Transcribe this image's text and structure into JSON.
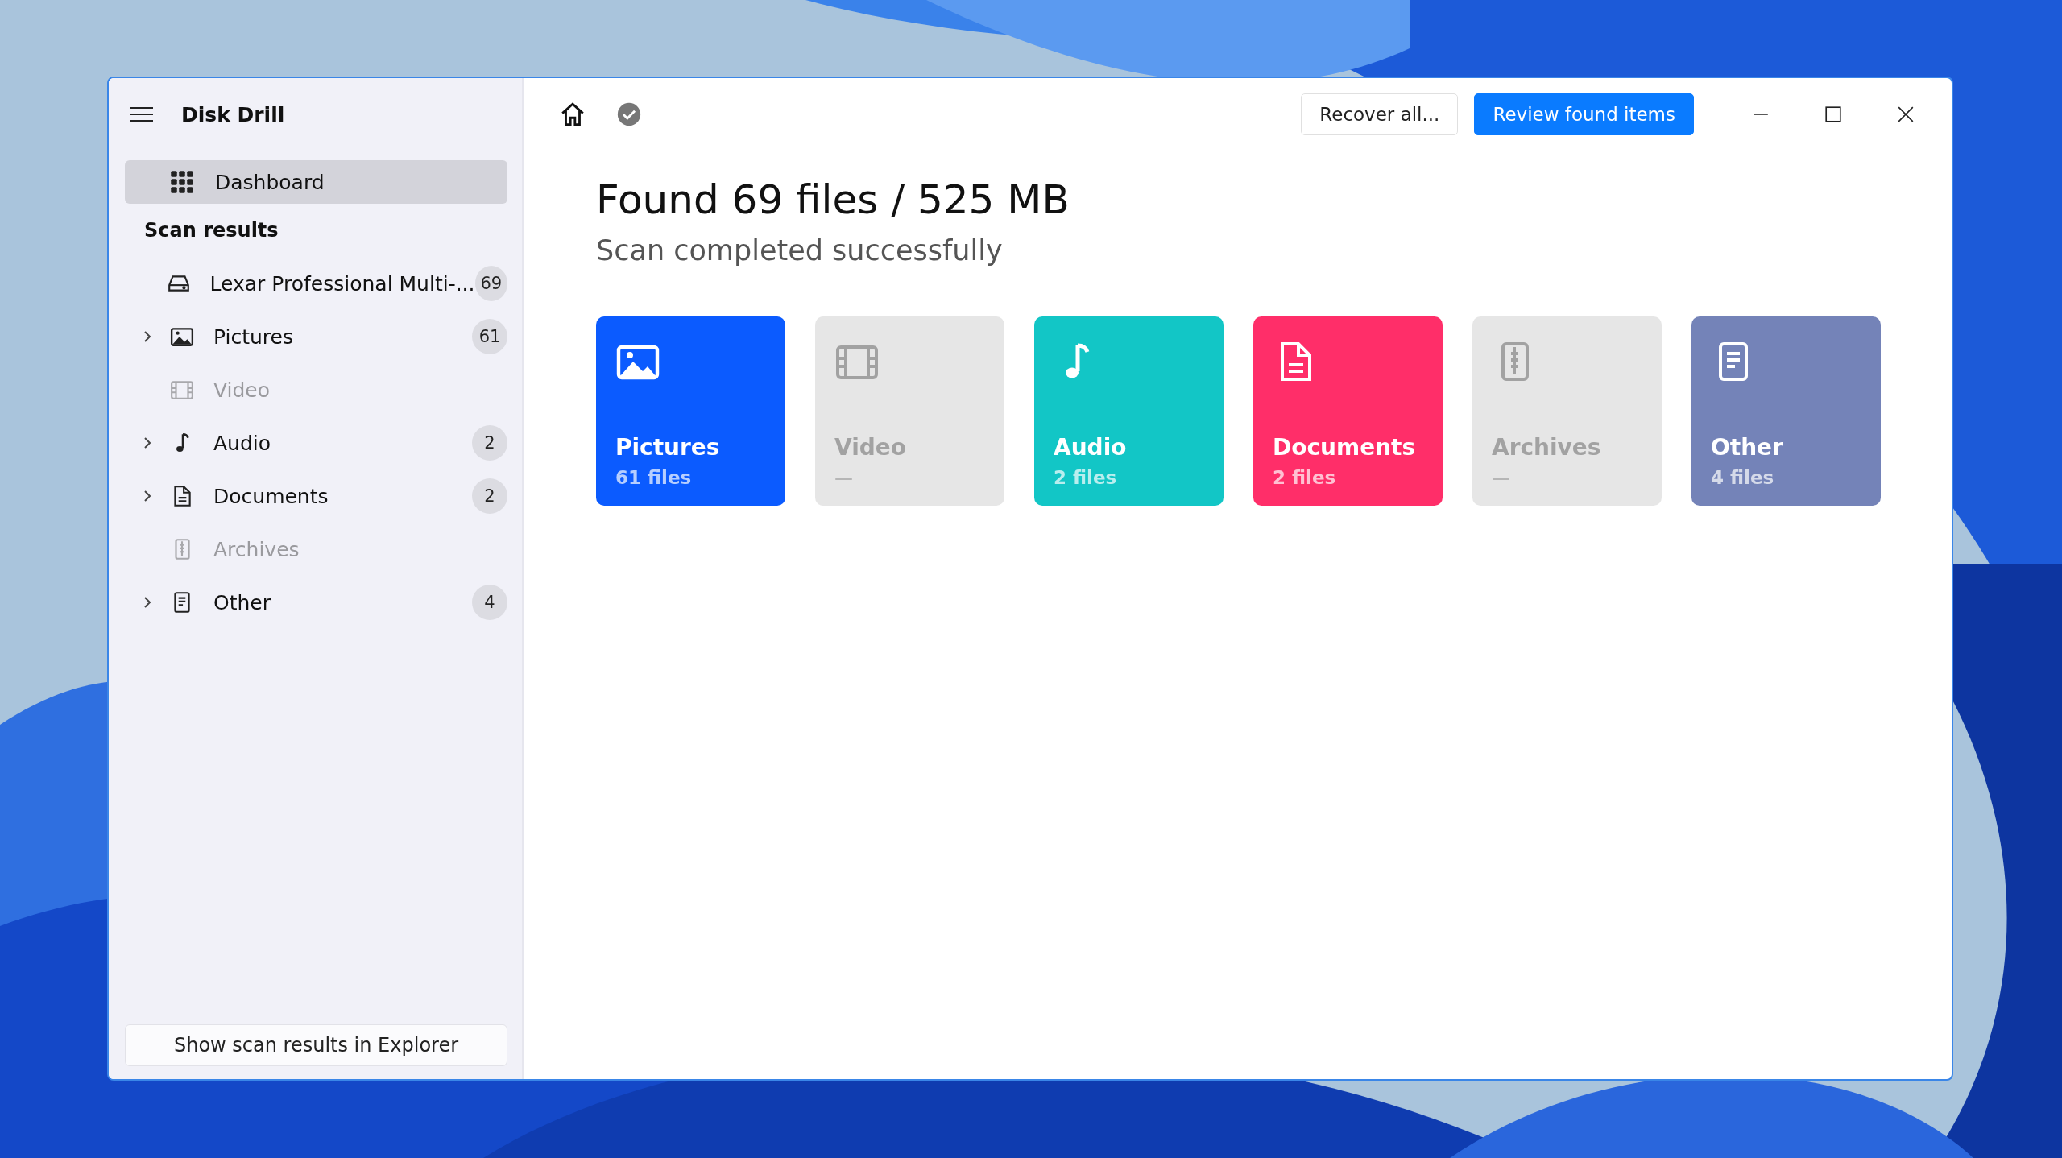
{
  "window": {
    "title": "Disk Drill"
  },
  "sidebar": {
    "nav": {
      "label": "Dashboard",
      "selected": true
    },
    "section_title": "Scan results",
    "items": [
      {
        "kind": "drive",
        "label": "Lexar Professional Multi-...",
        "count": "69",
        "expandable": false,
        "disabled": false
      },
      {
        "kind": "pictures",
        "label": "Pictures",
        "count": "61",
        "expandable": true,
        "disabled": false
      },
      {
        "kind": "video",
        "label": "Video",
        "expandable": false,
        "disabled": true
      },
      {
        "kind": "audio",
        "label": "Audio",
        "count": "2",
        "expandable": true,
        "disabled": false
      },
      {
        "kind": "documents",
        "label": "Documents",
        "count": "2",
        "expandable": true,
        "disabled": false
      },
      {
        "kind": "archives",
        "label": "Archives",
        "expandable": false,
        "disabled": true
      },
      {
        "kind": "other",
        "label": "Other",
        "count": "4",
        "expandable": true,
        "disabled": false
      }
    ],
    "footer_button": "Show scan results in Explorer"
  },
  "toolbar": {
    "buttons": [
      {
        "label": "Recover all...",
        "primary": false
      },
      {
        "label": "Review found items",
        "primary": true
      }
    ]
  },
  "heading": "Found 69 files / 525 MB",
  "status": "Scan completed successfully",
  "cards": [
    {
      "kind": "pictures",
      "label": "Pictures",
      "detail": "61 files",
      "disabled": false,
      "color": "#0b5bff"
    },
    {
      "kind": "video",
      "label": "Video",
      "detail": "—",
      "disabled": true
    },
    {
      "kind": "audio",
      "label": "Audio",
      "detail": "2 files",
      "disabled": false,
      "color": "#12c6c6"
    },
    {
      "kind": "documents",
      "label": "Documents",
      "detail": "2 files",
      "disabled": false,
      "color": "#ff2e69"
    },
    {
      "kind": "archives",
      "label": "Archives",
      "detail": "—",
      "disabled": true
    },
    {
      "kind": "other",
      "label": "Other",
      "detail": "4 files",
      "disabled": false,
      "color": "#7483b8"
    }
  ]
}
